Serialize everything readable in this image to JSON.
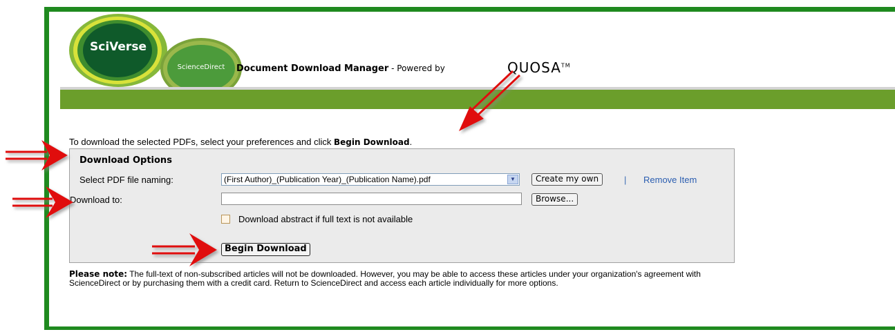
{
  "branding": {
    "sciverse_label": "SciVerse",
    "sciencedirect_label": "ScienceDirect",
    "title_bold": "Document Download Manager",
    "title_suffix": " - Powered by ",
    "quosa_label": "QUOSA",
    "quosa_tm": "TM"
  },
  "instruction": {
    "text": "To download the selected PDFs, select your preferences and click ",
    "bold": "Begin Download",
    "end": "."
  },
  "options": {
    "title": "Download Options",
    "naming_label": "Select PDF file naming:",
    "naming_value": "(First Author)_(Publication Year)_(Publication Name).pdf",
    "create_own_label": "Create my own",
    "separator": "|",
    "remove_item_label": "Remove Item",
    "download_to_label": "Download to:",
    "download_to_value": "",
    "browse_label": "Browse...",
    "abstract_checkbox_label": "Download abstract if full text is not available",
    "abstract_checked": false,
    "begin_download_label": "Begin Download"
  },
  "note": {
    "bold": "Please note:",
    "text": " The full-text of non-subscribed articles will not be downloaded. However, you may be able to access these articles under your organization's agreement with ScienceDirect or by purchasing them with a credit card. Return to ScienceDirect and access each article individually for more options."
  },
  "colors": {
    "frame_green": "#1f8a1f",
    "bar_green": "#6b9e2b",
    "arrow_red": "#e01010",
    "link_blue": "#2a5db0"
  }
}
